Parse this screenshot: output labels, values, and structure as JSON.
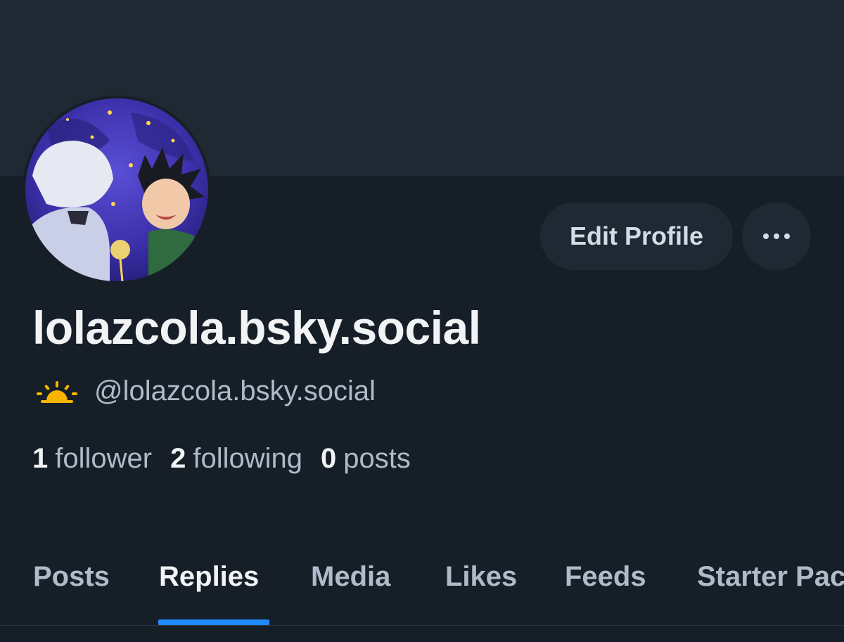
{
  "profile": {
    "display_name": "lolazcola.bsky.social",
    "handle": "@lolazcola.bsky.social",
    "handle_icon": "sunrise-emoji-icon"
  },
  "actions": {
    "edit_profile_label": "Edit Profile",
    "more_icon": "more-horizontal-icon"
  },
  "stats": [
    {
      "value": "1",
      "label": "follower"
    },
    {
      "value": "2",
      "label": "following"
    },
    {
      "value": "0",
      "label": "posts"
    }
  ],
  "tabs": [
    {
      "label": "Posts",
      "active": false
    },
    {
      "label": "Replies",
      "active": true
    },
    {
      "label": "Media",
      "active": false
    },
    {
      "label": "Likes",
      "active": false
    },
    {
      "label": "Feeds",
      "active": false
    },
    {
      "label": "Starter Packs",
      "active": false
    }
  ],
  "colors": {
    "background": "#161e27",
    "banner": "#1e2933",
    "accent": "#208bfe",
    "muted_text": "#aebbc9"
  }
}
